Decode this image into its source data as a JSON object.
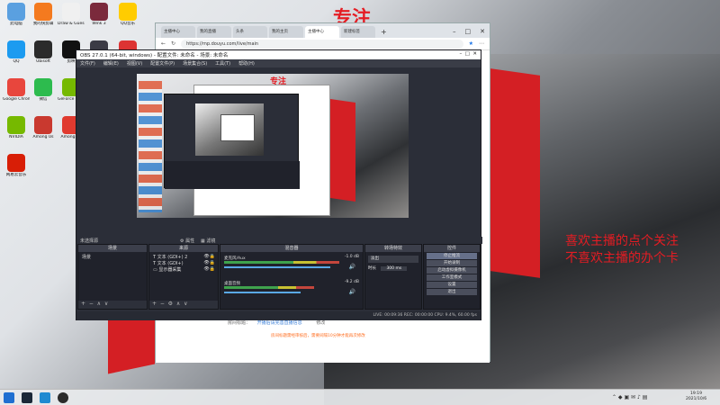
{
  "wallpaper": {
    "top_text": "专注",
    "side_line1": "喜欢主播的点个关注",
    "side_line2": "不喜欢主播的办个卡"
  },
  "desktop_icons": [
    {
      "label": "此电脑",
      "color": "#5aa0e0"
    },
    {
      "label": "我的快剪辑",
      "color": "#f47a1f"
    },
    {
      "label": "Draw & Guess",
      "color": "#f0f0f0"
    },
    {
      "label": "Wink 3",
      "color": "#7b2a3c"
    },
    {
      "label": "QQ音乐",
      "color": "#ffcc00"
    },
    {
      "label": "QQ",
      "color": "#1c9bf0"
    },
    {
      "label": "Ubisoft",
      "color": "#2b2b2b"
    },
    {
      "label": "剪映",
      "color": "#111111"
    },
    {
      "label": "OBS",
      "color": "#3b3b45"
    },
    {
      "label": "WeGame",
      "color": "#d33"
    },
    {
      "label": "Google Chrome",
      "color": "#e8463d"
    },
    {
      "label": "微信",
      "color": "#2dbb4e"
    },
    {
      "label": "GeForce Experience",
      "color": "#76b900"
    },
    {
      "label": "英雄联盟",
      "color": "#c9a24a"
    },
    {
      "label": "文件夹",
      "color": "#f3c243"
    },
    {
      "label": "NVIDIA",
      "color": "#76b900"
    },
    {
      "label": "Among Us",
      "color": "#c9392f"
    },
    {
      "label": "Among Us",
      "color": "#e03a2f"
    },
    {
      "label": "Steam",
      "color": "#1b2838"
    },
    {
      "label": "Edge",
      "color": "#1f8ad1"
    },
    {
      "label": "网易云音乐",
      "color": "#d81e06"
    }
  ],
  "browser": {
    "tabs": [
      "主播中心",
      "我的直播",
      "头条",
      "我的主页",
      "主播中心",
      "新建标签"
    ],
    "url": "https://mp.douyu.com/live/main",
    "notice_label": "房间标题：",
    "notice_text": "开播后请完善直播信息",
    "notice_action": "修改",
    "notice_warning": "房间标题需经审核后，需要间隔10分钟才能再次修改"
  },
  "obs": {
    "title": "OBS 27.0.1 (64-bit, windows) - 配置文件: 未命名 - 场景: 未命名",
    "menu": [
      "文件(F)",
      "编辑(E)",
      "视图(V)",
      "配置文件(P)",
      "场景集合(S)",
      "工具(T)",
      "帮助(H)"
    ],
    "preview_top_text": "专注",
    "no_source_label": "未选择源",
    "props_label": "属性",
    "filters_label": "滤镜",
    "panels": {
      "scenes": "场景",
      "sources": "来源",
      "mixer": "混音器",
      "transitions": "转场特效",
      "controls": "控件"
    },
    "scenes": [
      "场景"
    ],
    "sources": [
      "文本 (GDI+) 2",
      "文本 (GDI+)",
      "显示器采集"
    ],
    "mixer": [
      {
        "name": "麦克风/Aux",
        "db": "-1.0 dB"
      },
      {
        "name": "桌面音频",
        "db": "-9.2 dB"
      }
    ],
    "transition": {
      "type": "淡出",
      "duration_label": "时长",
      "duration": "300 ms"
    },
    "controls": [
      "停止推流",
      "开始录制",
      "启动虚拟摄像机",
      "工作室模式",
      "设置",
      "退出"
    ],
    "status": "LIVE: 00:09:36   REC: 00:00:00   CPU: 9.4%, 60.00 fps"
  },
  "taskbar": {
    "time": "19:19",
    "date": "2021/10/6"
  }
}
